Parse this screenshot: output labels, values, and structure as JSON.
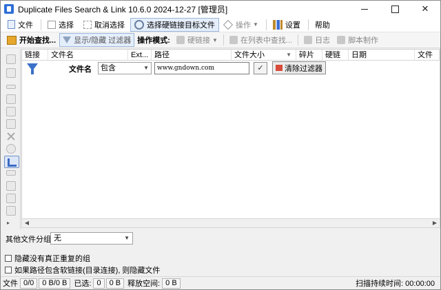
{
  "window": {
    "title": "Duplicate Files Search & Link 10.6.0 2024-12-27 [管理员]"
  },
  "menubar": {
    "items": [
      {
        "label": "文件",
        "icon": "file-icon"
      },
      {
        "label": "选择",
        "icon": "select-icon"
      },
      {
        "label": "取消选择",
        "icon": "unselect-icon"
      },
      {
        "label": "选择硬链接目标文件",
        "icon": "hardlink-target-icon"
      },
      {
        "label": "操作",
        "icon": "action-icon"
      },
      {
        "label": "设置",
        "icon": "settings-icon"
      },
      {
        "label": "帮助"
      }
    ]
  },
  "toolbar": {
    "start_search": "开始查找...",
    "toggle_filter": "显示/隐藏 过滤器",
    "mode_label": "操作模式:",
    "hardlink": "硬链接",
    "find_in_list": "在列表中查找...",
    "log": "日志",
    "script": "脚本制作"
  },
  "grid": {
    "columns": [
      "链接",
      "文件名",
      "Ext...",
      "路径",
      "文件大小",
      "碎片",
      "硬链",
      "日期",
      "文件"
    ]
  },
  "filter": {
    "field_label": "文件名",
    "condition": "包含",
    "value": "www.gndown.com",
    "apply_icon": "✓",
    "clear_label": "清除过滤器"
  },
  "bottom": {
    "group_label": "其他文件分组",
    "group_value": "无",
    "hide_unreal_label": "隐藏没有真正重复的组",
    "hide_symlink_label": "如果路径包含软链接(目录连接), 则隐藏文件"
  },
  "statusbar": {
    "file_label": "文件",
    "file_count": "0/0",
    "file_size": "0 B/0 B",
    "selected_label": "已选:",
    "selected_count": "0",
    "selected_size": "0 B",
    "free_label": "释放空间:",
    "free_value": "0 B",
    "scan_time": "扫描持续时间: 00:00:00"
  }
}
